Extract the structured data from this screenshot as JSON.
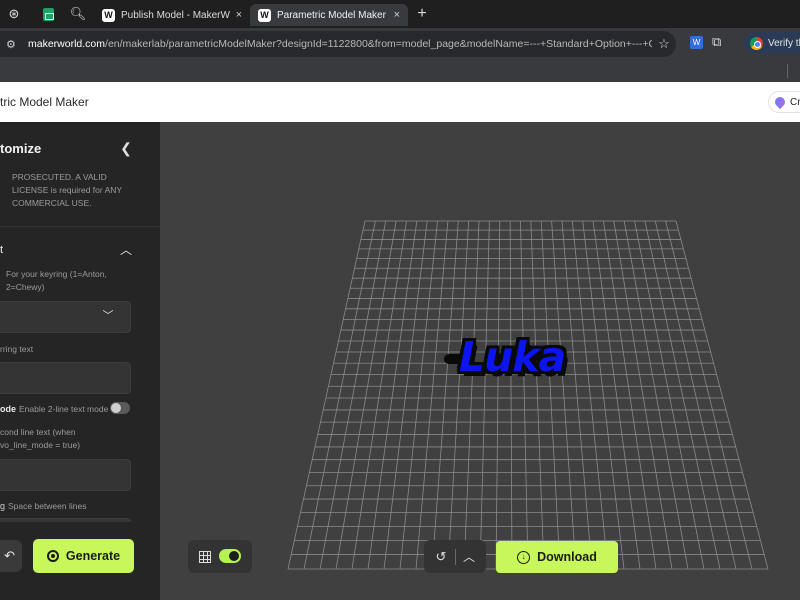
{
  "browser": {
    "tabs": [
      {
        "title": "Publish Model - MakerWorld",
        "icon": "makerworld-icon",
        "close": "×"
      },
      {
        "title": "Parametric Model Maker",
        "icon": "makerworld-icon",
        "close": "×"
      }
    ],
    "pinned_icons": [
      "openai-icon",
      "sheets-icon",
      "search-icon"
    ],
    "new_tab": "+",
    "url": {
      "host": "makerworld.com",
      "path": "/en/makerlab/parametricModelMaker?designId=1122800&from=model_page&modelName=---+Standard+Option+---+Cust..."
    },
    "extension_badge": "W",
    "profile_button": "Verify th"
  },
  "app": {
    "title": "tric Model Maker",
    "credit_button": "Cre"
  },
  "panel": {
    "title": "tomize",
    "license_text": "PROSECUTED. A VALID LICENSE is required for ANY COMMERCIAL USE.",
    "section_title": "t",
    "font_help": "For your keyring (1=Anton,",
    "font_help_2": "2=Chewy)",
    "text_help": "rring text",
    "mode_label": "ode",
    "mode_help": "Enable 2-line text mode",
    "mode_enabled": false,
    "second_line_help": "cond line text (when",
    "second_line_help_2": "vo_line_mode = true)",
    "spacing_label": "g",
    "spacing_help": "Space between lines",
    "undo_icon": "↶",
    "generate_label": "Generate"
  },
  "viewport": {
    "model_text": "Luka",
    "grid_enabled": true,
    "download_label": "Download"
  },
  "colors": {
    "accent": "#c7f75a",
    "model_fill": "#0c14f0",
    "viewport_bg": "#404040",
    "panel_bg": "#252525"
  }
}
